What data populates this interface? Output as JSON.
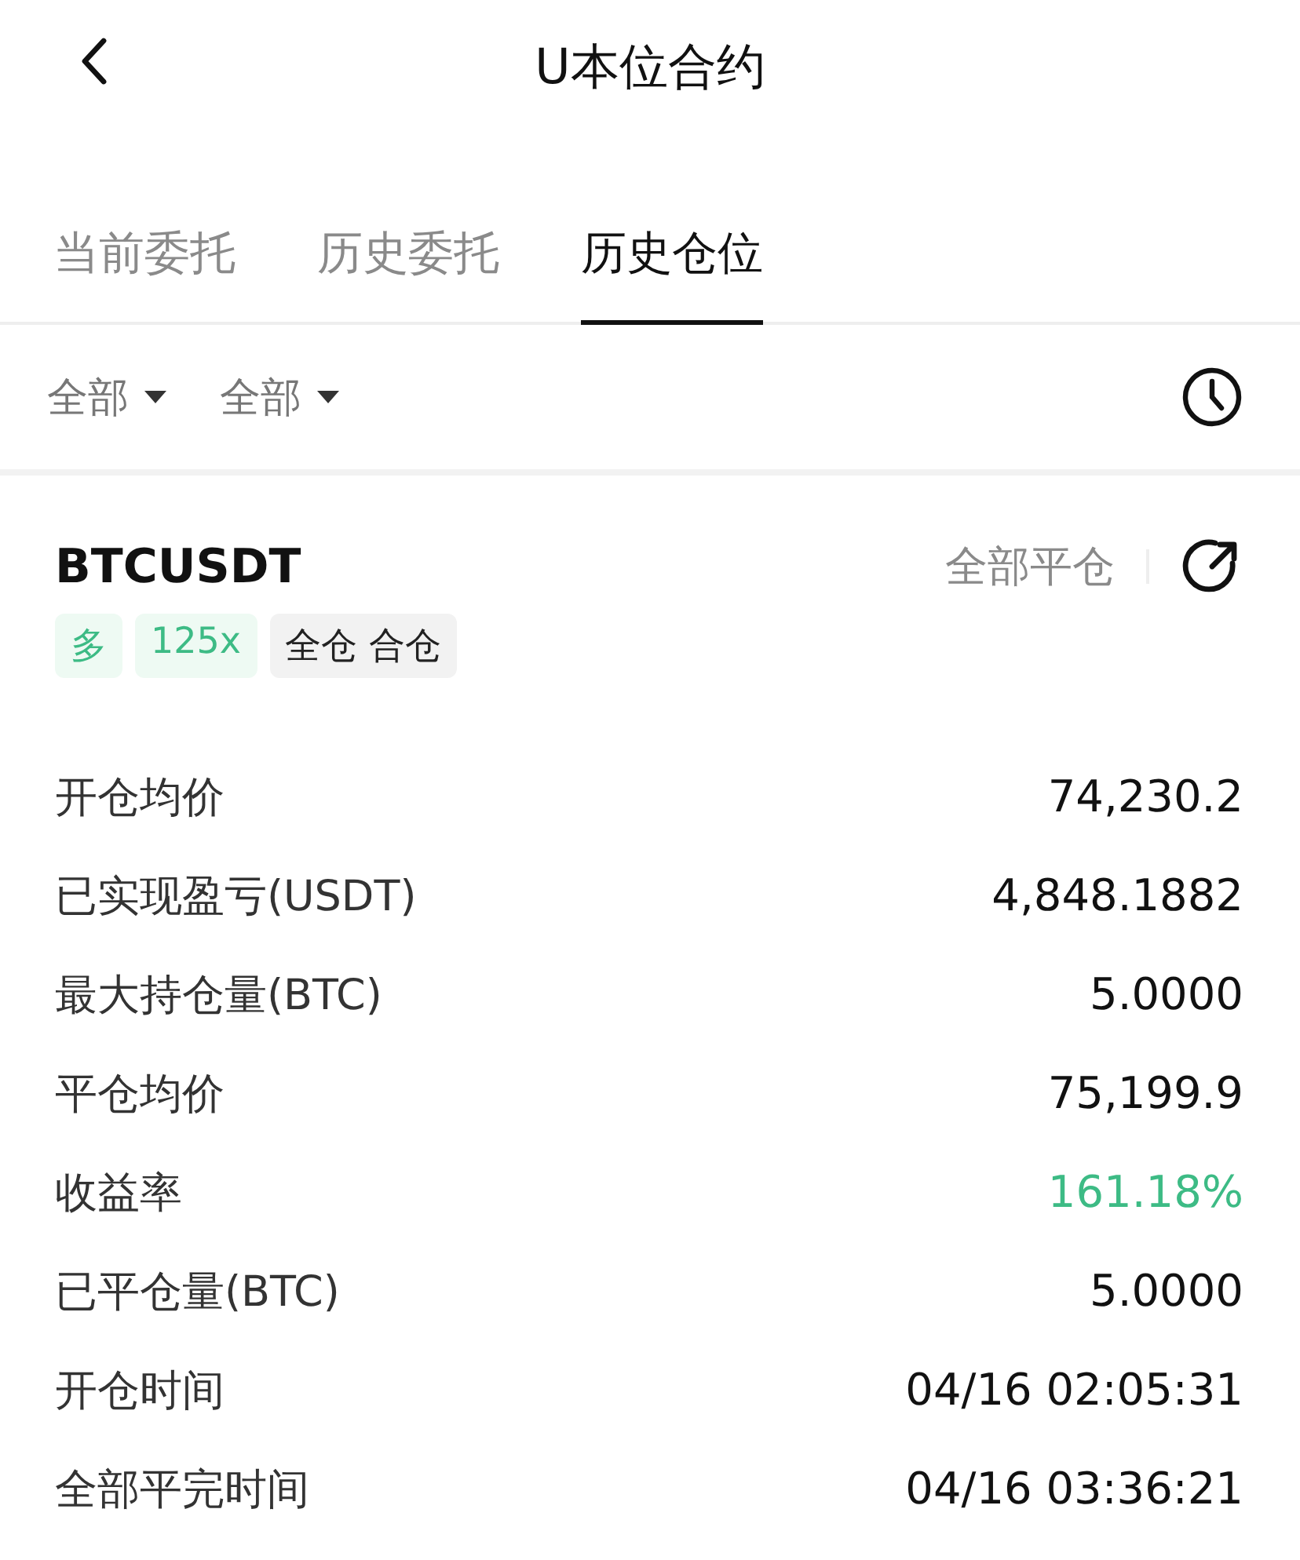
{
  "header": {
    "title": "U本位合约"
  },
  "tabs": [
    {
      "label": "当前委托",
      "selected": false
    },
    {
      "label": "历史委托",
      "selected": false
    },
    {
      "label": "历史仓位",
      "selected": true
    }
  ],
  "filters": [
    {
      "label": "全部"
    },
    {
      "label": "全部"
    }
  ],
  "position": {
    "symbol": "BTCUSDT",
    "close_all": "全部平仓",
    "tags": [
      {
        "label": "多",
        "kind": "side"
      },
      {
        "label": "125x",
        "kind": "leverage"
      },
      {
        "label": "全仓 合仓",
        "kind": "mode"
      }
    ],
    "rows": [
      {
        "label": "开仓均价",
        "value": "74,230.2",
        "kind": "plain"
      },
      {
        "label": "已实现盈亏(USDT)",
        "value": "4,848.1882",
        "kind": "plain"
      },
      {
        "label": "最大持仓量(BTC)",
        "value": "5.0000",
        "kind": "plain"
      },
      {
        "label": "平仓均价",
        "value": "75,199.9",
        "kind": "plain"
      },
      {
        "label": "收益率",
        "value": "161.18%",
        "kind": "gain"
      },
      {
        "label": "已平仓量(BTC)",
        "value": "5.0000",
        "kind": "plain"
      },
      {
        "label": "开仓时间",
        "value": "04/16 02:05:31",
        "kind": "plain"
      },
      {
        "label": "全部平完时间",
        "value": "04/16 03:36:21",
        "kind": "plain"
      }
    ]
  }
}
